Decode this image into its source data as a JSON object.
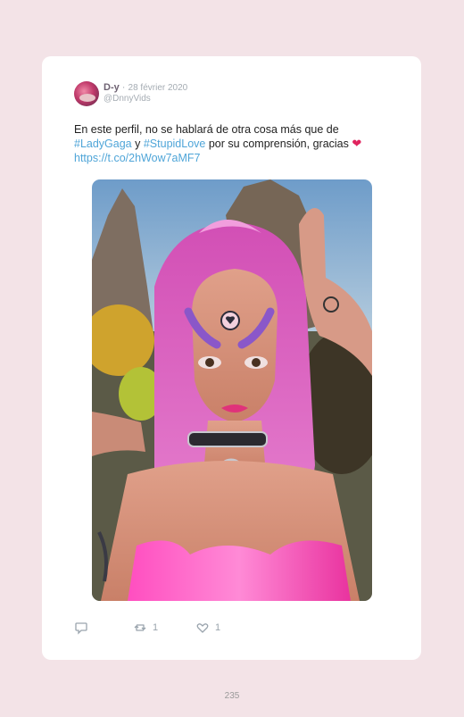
{
  "tweet": {
    "display_name": "D-y",
    "separator": "·",
    "date": "28 février 2020",
    "handle": "@DnnyVids",
    "text_part1": "En este perfil, no se hablará de otra cosa más que de",
    "hashtag1": "#LadyGaga",
    "text_part2": "y",
    "hashtag2": "#StupidLove",
    "text_part3": "por su comprensión, gracias",
    "emoji": "❤",
    "link": "https://t.co/2hWow7aMF7"
  },
  "actions": {
    "reply_icon": "reply-icon",
    "retweet_icon": "retweet-icon",
    "like_icon": "heart-icon",
    "retweet_count": "1",
    "like_count": "1"
  },
  "footer": {
    "page_number": "235"
  },
  "colors": {
    "background": "#f3e3e7",
    "card": "#ffffff",
    "link": "#4fa5d8",
    "icon": "#9aa4ad",
    "heart": "#e0245e"
  }
}
